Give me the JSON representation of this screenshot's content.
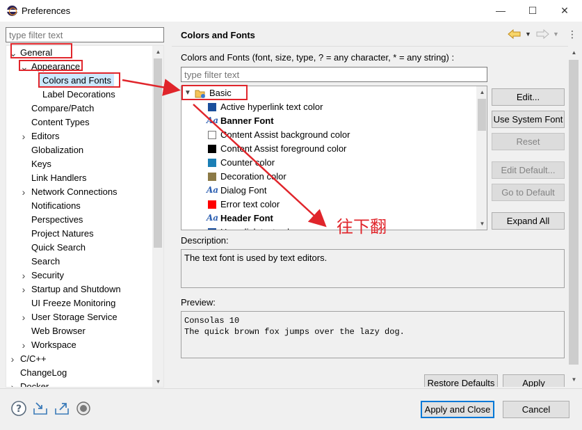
{
  "window": {
    "title": "Preferences",
    "minimize": "—",
    "maximize": "☐",
    "close": "✕"
  },
  "left": {
    "filter_placeholder": "type filter text",
    "tree": [
      {
        "label": "General",
        "indent": 0,
        "twisty": "expanded"
      },
      {
        "label": "Appearance",
        "indent": 1,
        "twisty": "expanded"
      },
      {
        "label": "Colors and Fonts",
        "indent": 2,
        "twisty": "none",
        "selected": true
      },
      {
        "label": "Label Decorations",
        "indent": 2,
        "twisty": "none"
      },
      {
        "label": "Compare/Patch",
        "indent": 1,
        "twisty": "none"
      },
      {
        "label": "Content Types",
        "indent": 1,
        "twisty": "none"
      },
      {
        "label": "Editors",
        "indent": 1,
        "twisty": "collapsed"
      },
      {
        "label": "Globalization",
        "indent": 1,
        "twisty": "none"
      },
      {
        "label": "Keys",
        "indent": 1,
        "twisty": "none"
      },
      {
        "label": "Link Handlers",
        "indent": 1,
        "twisty": "none"
      },
      {
        "label": "Network Connections",
        "indent": 1,
        "twisty": "collapsed"
      },
      {
        "label": "Notifications",
        "indent": 1,
        "twisty": "none"
      },
      {
        "label": "Perspectives",
        "indent": 1,
        "twisty": "none"
      },
      {
        "label": "Project Natures",
        "indent": 1,
        "twisty": "none"
      },
      {
        "label": "Quick Search",
        "indent": 1,
        "twisty": "none"
      },
      {
        "label": "Search",
        "indent": 1,
        "twisty": "none"
      },
      {
        "label": "Security",
        "indent": 1,
        "twisty": "collapsed"
      },
      {
        "label": "Startup and Shutdown",
        "indent": 1,
        "twisty": "collapsed"
      },
      {
        "label": "UI Freeze Monitoring",
        "indent": 1,
        "twisty": "none"
      },
      {
        "label": "User Storage Service",
        "indent": 1,
        "twisty": "collapsed"
      },
      {
        "label": "Web Browser",
        "indent": 1,
        "twisty": "none"
      },
      {
        "label": "Workspace",
        "indent": 1,
        "twisty": "collapsed"
      },
      {
        "label": "C/C++",
        "indent": 0,
        "twisty": "collapsed"
      },
      {
        "label": "ChangeLog",
        "indent": 0,
        "twisty": "none"
      },
      {
        "label": "Docker",
        "indent": 0,
        "twisty": "collapsed"
      }
    ]
  },
  "right": {
    "page_title": "Colors and Fonts",
    "colors_fonts_label": "Colors and Fonts (font, size, type, ? = any character, * = any string) :",
    "filter_placeholder": "type filter text",
    "category": "Basic",
    "items": [
      {
        "label": "Active hyperlink text color",
        "kind": "color",
        "color": "#1b4f9c",
        "bold": false
      },
      {
        "label": "Banner Font",
        "kind": "font",
        "bold": true
      },
      {
        "label": "Content Assist background color",
        "kind": "color",
        "color": "#ffffff",
        "bold": false
      },
      {
        "label": "Content Assist foreground color",
        "kind": "color",
        "color": "#000000",
        "bold": false
      },
      {
        "label": "Counter color",
        "kind": "color",
        "color": "#1b7fb5",
        "bold": false
      },
      {
        "label": "Decoration color",
        "kind": "color",
        "color": "#8c7a46",
        "bold": false
      },
      {
        "label": "Dialog Font",
        "kind": "font",
        "bold": false
      },
      {
        "label": "Error text color",
        "kind": "color",
        "color": "#ff0000",
        "bold": false
      },
      {
        "label": "Header Font",
        "kind": "font",
        "bold": true
      },
      {
        "label": "Hyperlink text color",
        "kind": "color",
        "color": "#1b4f9c",
        "bold": false
      }
    ],
    "buttons": {
      "edit": "Edit...",
      "use_system_font": "Use System Font",
      "reset": "Reset",
      "edit_default": "Edit Default...",
      "go_to_default": "Go to Default",
      "expand_all": "Expand All"
    },
    "description_label": "Description:",
    "description_text": "The text font is used by text editors.",
    "preview_label": "Preview:",
    "preview_lines": [
      "Consolas 10",
      "The quick brown fox jumps over the lazy dog."
    ],
    "restore_defaults": "Restore Defaults",
    "apply": "Apply"
  },
  "bottom": {
    "apply_and_close": "Apply and Close",
    "cancel": "Cancel"
  },
  "annotation": {
    "text": "往下翻",
    "color": "#e0252b"
  }
}
